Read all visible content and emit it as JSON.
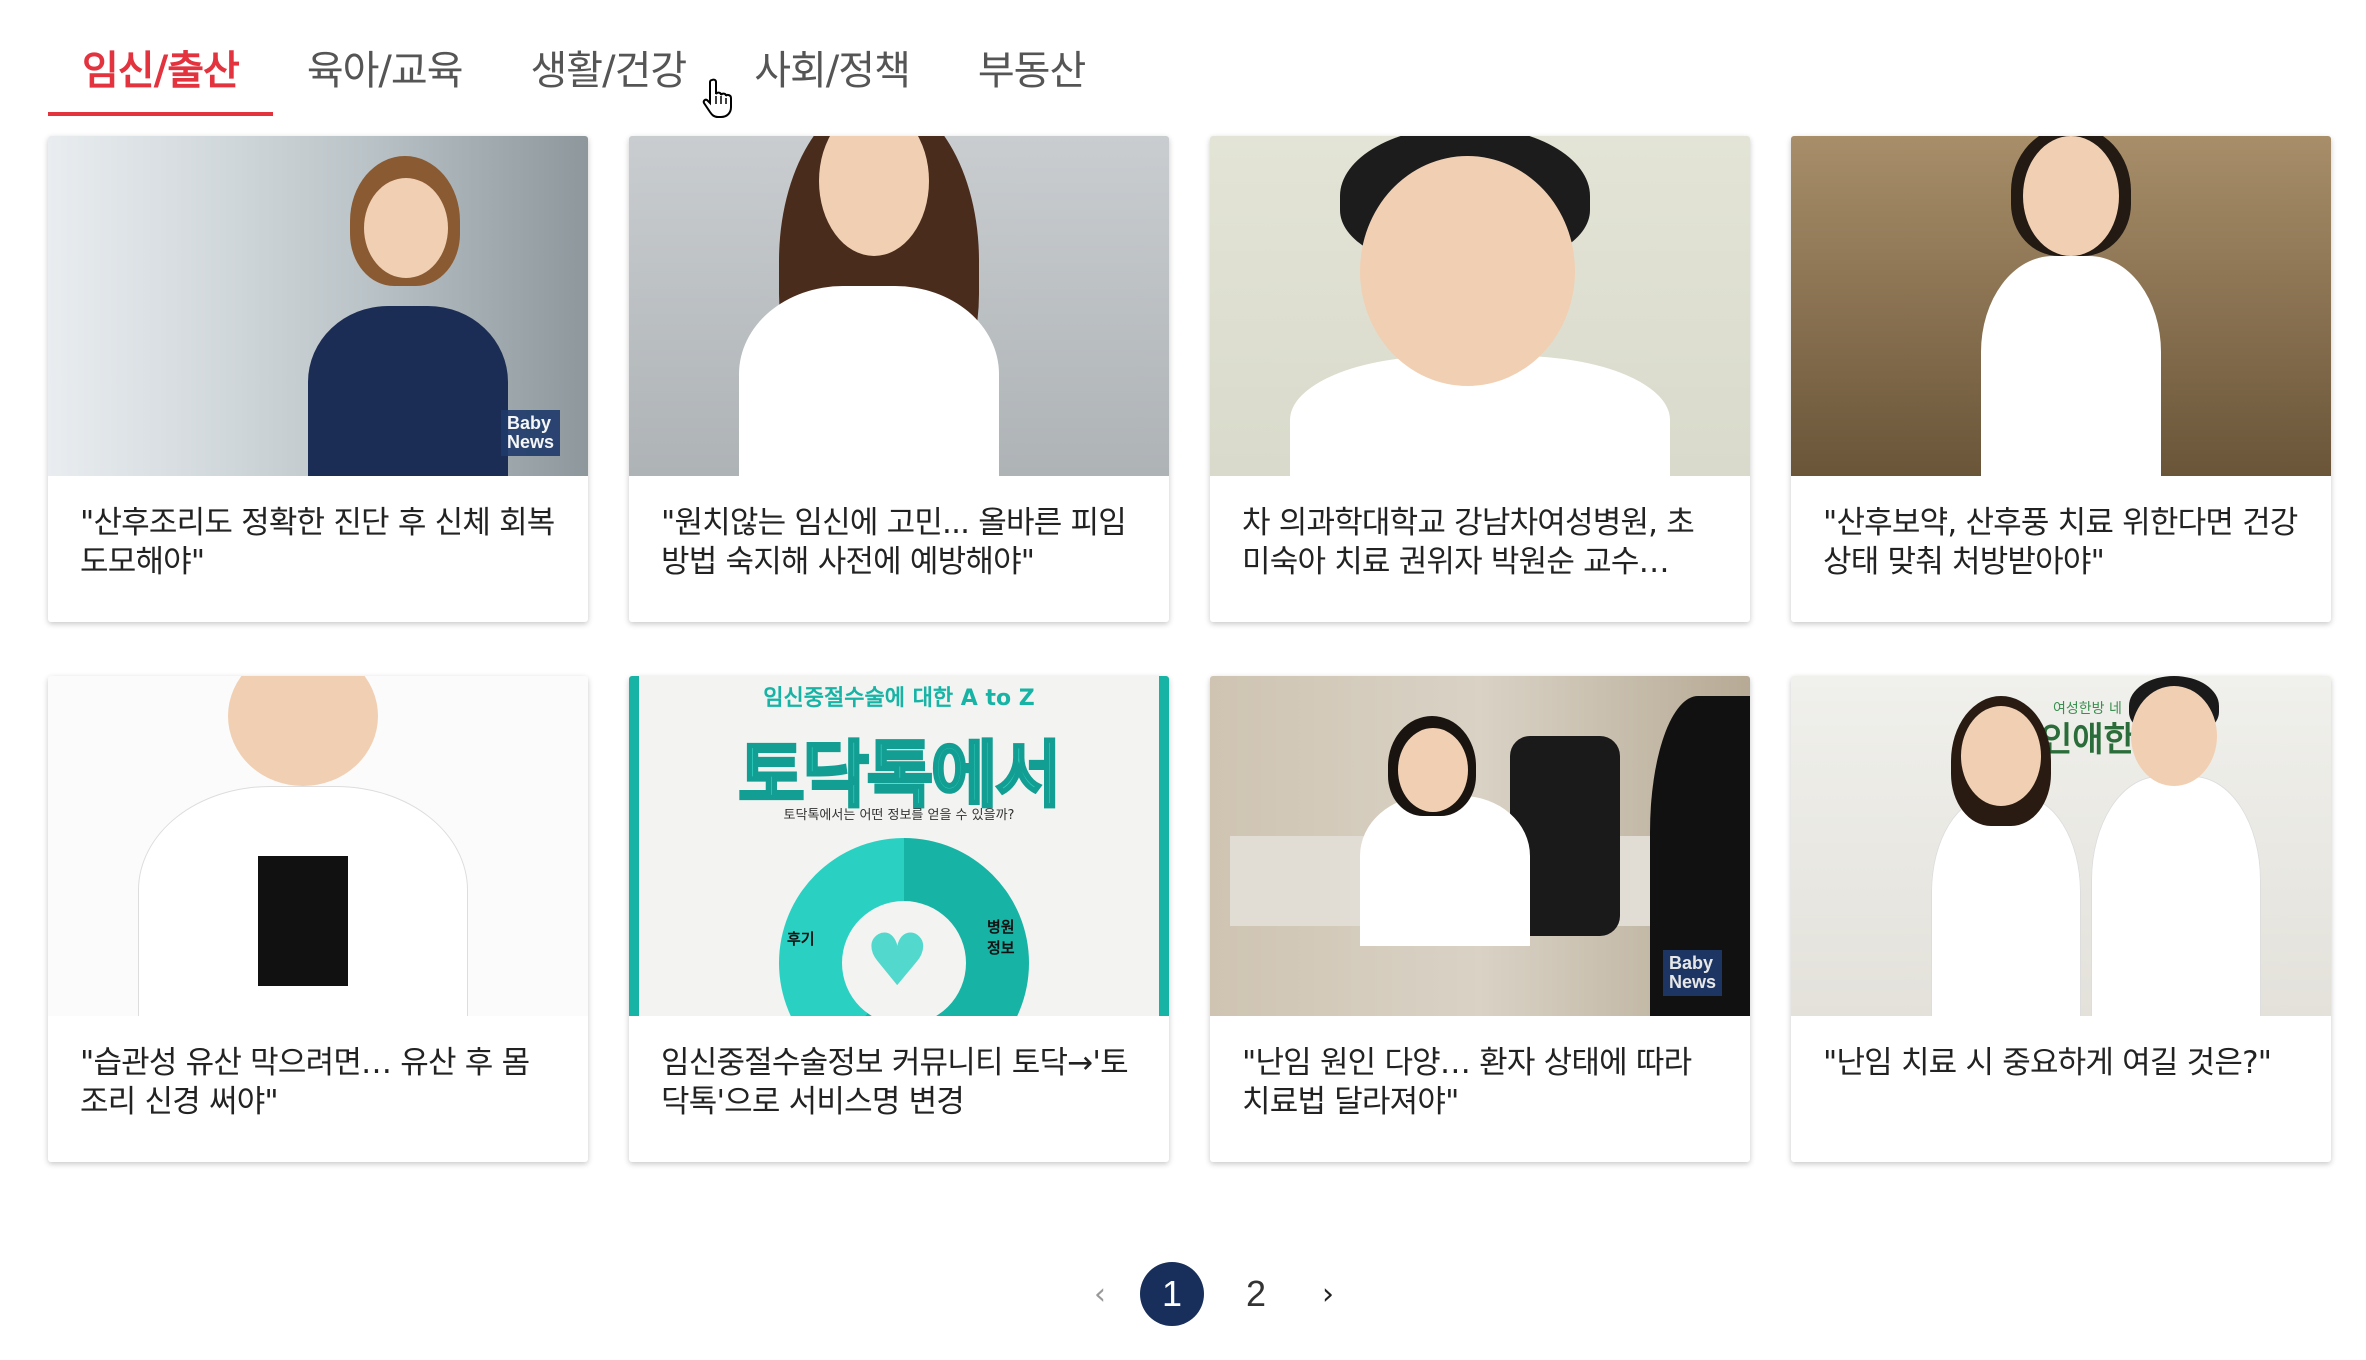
{
  "tabs": [
    {
      "label": "임신/출산",
      "active": true
    },
    {
      "label": "육아/교육",
      "active": false
    },
    {
      "label": "생활/건강",
      "active": false
    },
    {
      "label": "사회/정책",
      "active": false
    },
    {
      "label": "부동산",
      "active": false
    }
  ],
  "colors": {
    "accent": "#e2333f",
    "pager_active": "#172f5a",
    "teal": "#17b4a6"
  },
  "cards": [
    {
      "title": "\"산후조리도 정확한 진단 후 신체 회복 도모해야\"",
      "badge": "Baby\nNews"
    },
    {
      "title": "\"원치않는 임신에 고민... 올바른 피임방법 숙지해 사전에 예방해야\""
    },
    {
      "title": "차 의과학대학교 강남차여성병원, 초미숙아 치료 권위자 박원순 교수…"
    },
    {
      "title": "\"산후보약, 산후풍 치료 위한다면 건강상태 맞춰 처방받아야\""
    },
    {
      "title": "\"습관성 유산 막으려면… 유산 후 몸조리 신경 써야\""
    },
    {
      "title": "임신중절수술정보 커뮤니티 토닥→'토닥톡'으로 서비스명 변경",
      "image": {
        "subtitle": "임신중절수술에 대한 A to Z",
        "headline": "토닥톡에서",
        "question": "토닥톡에서는 어떤 정보를 얻을 수 있을까?",
        "left_label": "후기",
        "right_label": "병원\n정보"
      }
    },
    {
      "title": "\"난임 원인 다양… 환자 상태에 따라 치료법 달라져야\"",
      "badge": "Baby\nNews"
    },
    {
      "title": "\"난임 치료 시 중요하게 여길 것은?\"",
      "image": {
        "sign_small": "여성한방 네",
        "sign": "인애한으"
      }
    }
  ],
  "pagination": {
    "prev": "‹",
    "next": "›",
    "pages": [
      "1",
      "2"
    ],
    "current": "1"
  }
}
